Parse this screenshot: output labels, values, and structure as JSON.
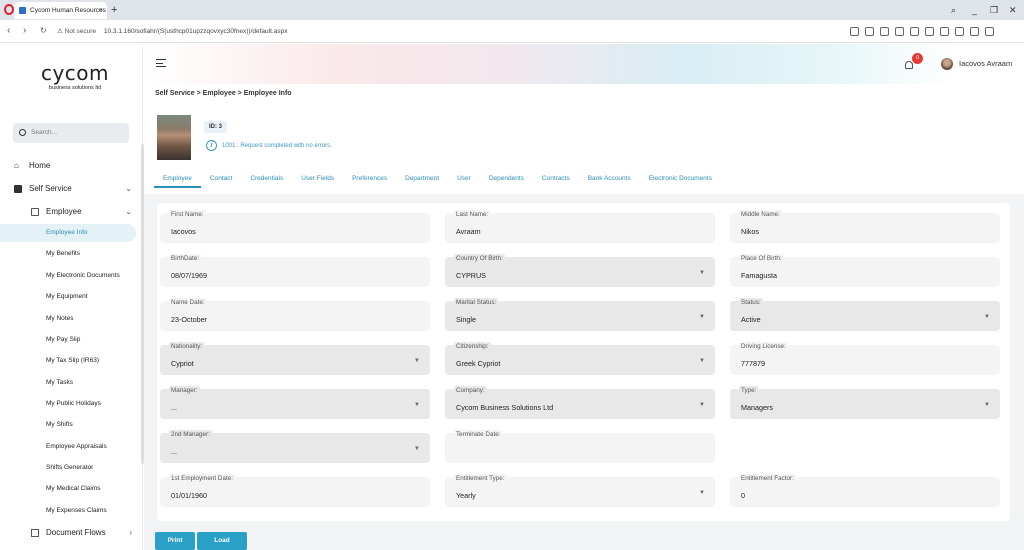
{
  "browser": {
    "tab_title": "Cycom Human Resources",
    "new_tab": "+",
    "not_secure": "Not secure",
    "url": "10.3.1.160/sofiahr/(S(usthcp01upzzqovxyc30fnex))/default.aspx"
  },
  "sidebar": {
    "logo_text": "cycom",
    "logo_sub": "business solutions ltd",
    "search_placeholder": "Search...",
    "home": "Home",
    "self_service": "Self Service",
    "employee": "Employee",
    "document_flows": "Document Flows",
    "sub_items": [
      "Employee Info",
      "My Benefits",
      "My Electronic Documents",
      "My Equipment",
      "My Notes",
      "My Pay Slip",
      "My Tax Slip (IR63)",
      "My Tasks",
      "My Public Holidays",
      "My Shifts",
      "Employee Appraisals",
      "Shifts Generator",
      "My Medical Claims",
      "My Expenses Claims"
    ]
  },
  "header": {
    "notification_count": "0",
    "user_name": "Iacovos Avraam"
  },
  "main": {
    "breadcrumb": "Self Service > Employee > Employee Info",
    "id_tag": "ID: 3",
    "message": "1001 : Request completed with no errors.",
    "tabs": [
      "Employee",
      "Contact",
      "Credentials",
      "User Fields",
      "Preferences",
      "Department",
      "User",
      "Dependents",
      "Contracts",
      "Bank Accounts",
      "Electronic Documents"
    ],
    "fields": [
      {
        "label": "First Name:",
        "value": "Iacovos"
      },
      {
        "label": "Last Name:",
        "value": "Avraam"
      },
      {
        "label": "Middle Name:",
        "value": "Nikos"
      },
      {
        "label": "BirthDate:",
        "value": "08/07/1969"
      },
      {
        "label": "Country Of Birth:",
        "value": "CYPRUS"
      },
      {
        "label": "Place Of Birth:",
        "value": "Famagusta"
      },
      {
        "label": "Name Date:",
        "value": "23-October"
      },
      {
        "label": "Marital Status:",
        "value": "Single"
      },
      {
        "label": "Status:",
        "value": "Active"
      },
      {
        "label": "Nationality:",
        "value": "Cypriot"
      },
      {
        "label": "Citizenship:",
        "value": "Greek Cypriot"
      },
      {
        "label": "Driving License:",
        "value": "777879"
      },
      {
        "label": "Manager:",
        "value": "..."
      },
      {
        "label": "Company:",
        "value": "Cycom Business Solutions Ltd"
      },
      {
        "label": "Type:",
        "value": "Managers"
      },
      {
        "label": "2nd Manager:",
        "value": "..."
      },
      {
        "label": "Terminate Date:",
        "value": ""
      },
      {
        "label": "1st Employment Date:",
        "value": "01/01/1960"
      },
      {
        "label": "Entitlement Type:",
        "value": "Yearly"
      },
      {
        "label": "Entitlement Factor:",
        "value": "0"
      }
    ],
    "print_button": "Print",
    "load_button": "Load"
  }
}
